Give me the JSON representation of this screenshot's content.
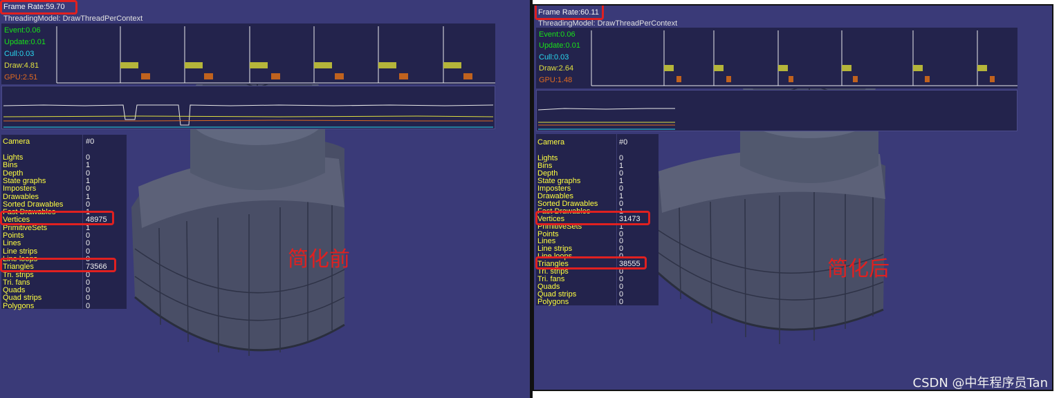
{
  "left": {
    "frame_rate": "Frame Rate:59.70",
    "threading_model": "ThreadingModel: DrawThreadPerContext",
    "timings": [
      {
        "label": "Event:0.06",
        "color": "#19e219"
      },
      {
        "label": "Update:0.01",
        "color": "#19e219"
      },
      {
        "label": "Cull:0.03",
        "color": "#29d8f0"
      },
      {
        "label": "Draw:4.81",
        "color": "#e0e040"
      },
      {
        "label": "GPU:2.51",
        "color": "#e06a20"
      }
    ],
    "stats": {
      "camera_label": "Camera",
      "camera_value": "#0",
      "rows": [
        {
          "label": "Lights",
          "value": "0"
        },
        {
          "label": "Bins",
          "value": "1"
        },
        {
          "label": "Depth",
          "value": "0"
        },
        {
          "label": "State graphs",
          "value": "1"
        },
        {
          "label": "Imposters",
          "value": "0"
        },
        {
          "label": "Drawables",
          "value": "1"
        },
        {
          "label": "Sorted Drawables",
          "value": "0"
        },
        {
          "label": "Fast Drawables",
          "value": "1"
        },
        {
          "label": "Vertices",
          "value": "48975"
        },
        {
          "label": "PrimitiveSets",
          "value": "1"
        },
        {
          "label": "Points",
          "value": "0"
        },
        {
          "label": "Lines",
          "value": "0"
        },
        {
          "label": "Line strips",
          "value": "0"
        },
        {
          "label": "Line loops",
          "value": "0"
        },
        {
          "label": "Triangles",
          "value": "73566"
        },
        {
          "label": "Tri. strips",
          "value": "0"
        },
        {
          "label": "Tri. fans",
          "value": "0"
        },
        {
          "label": "Quads",
          "value": "0"
        },
        {
          "label": "Quad strips",
          "value": "0"
        },
        {
          "label": "Polygons",
          "value": "0"
        }
      ]
    },
    "annotation": "简化前"
  },
  "right": {
    "frame_rate": "Frame Rate:60.11",
    "threading_model": "ThreadingModel: DrawThreadPerContext",
    "timings": [
      {
        "label": "Event:0.06",
        "color": "#19e219"
      },
      {
        "label": "Update:0.01",
        "color": "#19e219"
      },
      {
        "label": "Cull:0.03",
        "color": "#29d8f0"
      },
      {
        "label": "Draw:2.64",
        "color": "#e0e040"
      },
      {
        "label": "GPU:1.48",
        "color": "#e06a20"
      }
    ],
    "stats": {
      "camera_label": "Camera",
      "camera_value": "#0",
      "rows": [
        {
          "label": "Lights",
          "value": "0"
        },
        {
          "label": "Bins",
          "value": "1"
        },
        {
          "label": "Depth",
          "value": "0"
        },
        {
          "label": "State graphs",
          "value": "1"
        },
        {
          "label": "Imposters",
          "value": "0"
        },
        {
          "label": "Drawables",
          "value": "1"
        },
        {
          "label": "Sorted Drawables",
          "value": "0"
        },
        {
          "label": "Fast Drawables",
          "value": "1"
        },
        {
          "label": "Vertices",
          "value": "31473"
        },
        {
          "label": "PrimitiveSets",
          "value": "1"
        },
        {
          "label": "Points",
          "value": "0"
        },
        {
          "label": "Lines",
          "value": "0"
        },
        {
          "label": "Line strips",
          "value": "0"
        },
        {
          "label": "Line loops",
          "value": "0"
        },
        {
          "label": "Triangles",
          "value": "38555"
        },
        {
          "label": "Tri. strips",
          "value": "0"
        },
        {
          "label": "Tri. fans",
          "value": "0"
        },
        {
          "label": "Quads",
          "value": "0"
        },
        {
          "label": "Quad strips",
          "value": "0"
        },
        {
          "label": "Polygons",
          "value": "0"
        }
      ]
    },
    "annotation": "简化后"
  },
  "watermark": "CSDN @中年程序员Tan",
  "colors": {
    "background": "#3a3a78",
    "panel": "#23234c",
    "highlight": "#e02020",
    "stat_label": "#ffff40"
  }
}
